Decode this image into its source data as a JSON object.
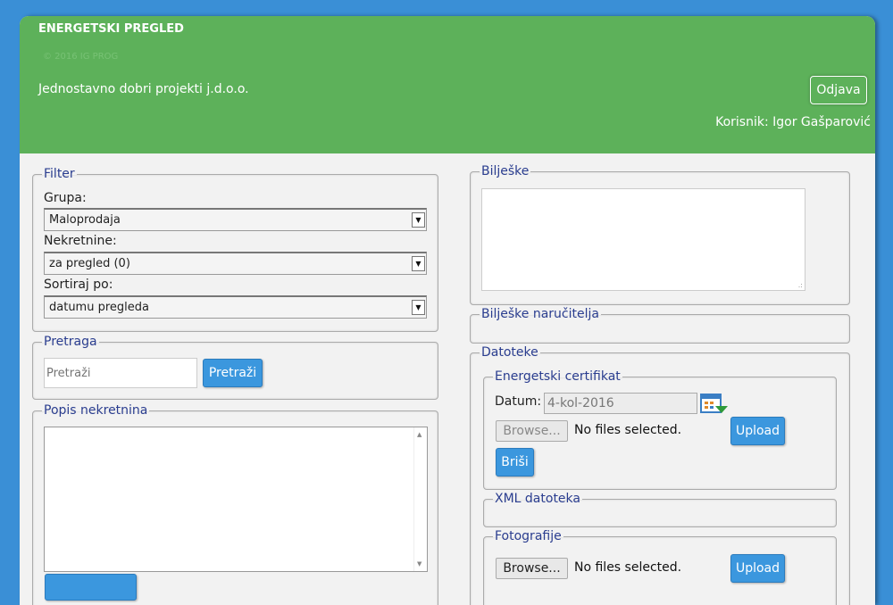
{
  "header": {
    "title": "ENERGETSKI PREGLED",
    "copyright": "© 2016 IG PROG",
    "company": "Jednostavno dobri projekti j.d.o.o.",
    "logout_label": "Odjava",
    "user_text": "Korisnik: Igor Gašparović"
  },
  "filter": {
    "legend": "Filter",
    "group_label": "Grupa:",
    "group_value": "Maloprodaja",
    "property_label": "Nekretnine:",
    "property_value": "za pregled (0)",
    "sort_label": "Sortiraj po:",
    "sort_value": "datumu pregleda"
  },
  "search": {
    "legend": "Pretraga",
    "placeholder": "Pretraži",
    "button_label": "Pretraži"
  },
  "property_list": {
    "legend": "Popis nekretnina"
  },
  "notes": {
    "legend": "Bilješke"
  },
  "client_notes": {
    "legend": "Bilješke naručitelja"
  },
  "files": {
    "legend": "Datoteke",
    "energy_certificate": {
      "legend": "Energetski certifikat",
      "date_label": "Datum:",
      "date_value": "4-kol-2016",
      "browse_label": "Browse...",
      "no_files": "No files selected.",
      "upload_label": "Upload",
      "delete_label": "Briši"
    },
    "xml": {
      "legend": "XML datoteka"
    },
    "photos": {
      "legend": "Fotografije",
      "browse_label": "Browse...",
      "no_files": "No files selected.",
      "upload_label": "Upload"
    }
  },
  "colors": {
    "header_green": "#5db15a",
    "page_blue": "#3a8fd6",
    "button_blue": "#3b97de",
    "legend_blue": "#2a3d8f"
  },
  "icons": {
    "dropdown": "chevron-down-icon",
    "calendar": "calendar-icon"
  }
}
